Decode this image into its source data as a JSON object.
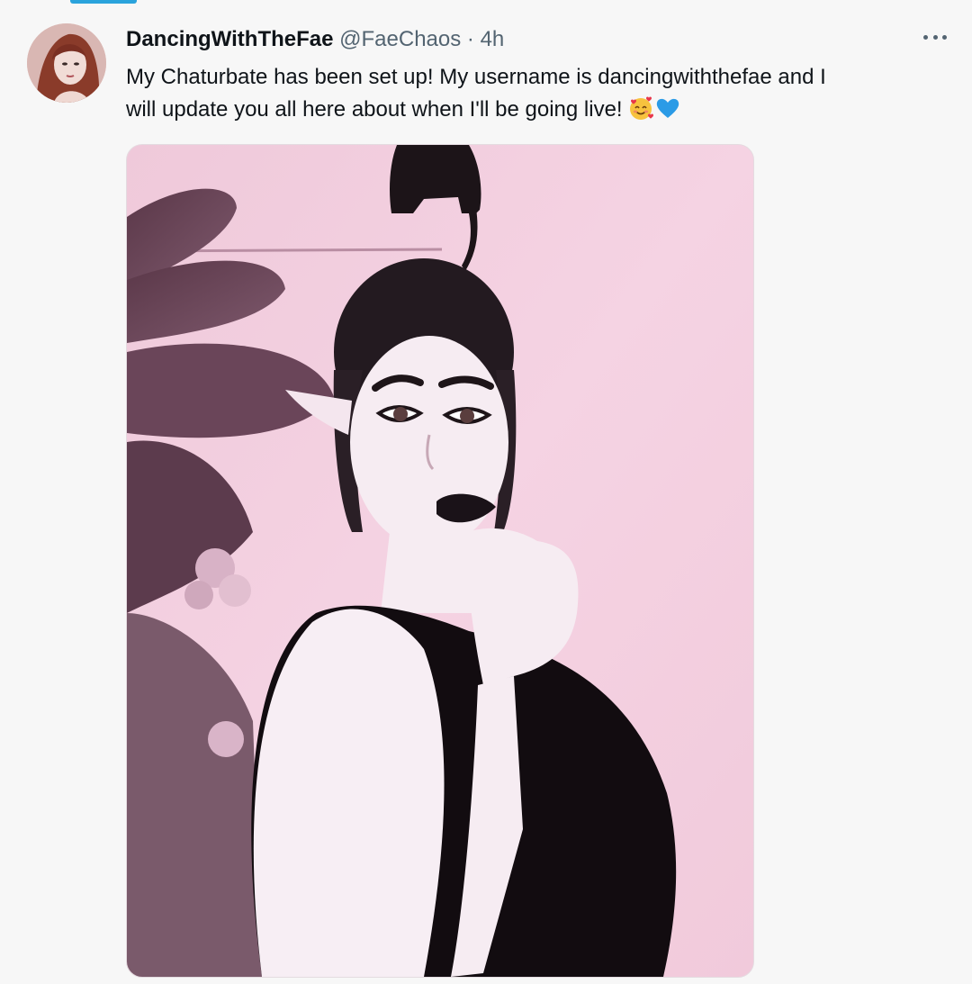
{
  "tweet": {
    "display_name": "DancingWithTheFae",
    "handle": "@FaeChaos",
    "separator": "·",
    "time": "4h",
    "text_line1": "My Chaturbate has been set up! My username is dancingwiththefae and I",
    "text_line2": "will update you all here about when I'll be going live!",
    "emojis": [
      "smiling-face-with-hearts-icon",
      "blue-heart-icon"
    ]
  },
  "colors": {
    "accent": "#2aa3dc",
    "background": "#f7f7f7",
    "secondary_text": "#536471"
  }
}
